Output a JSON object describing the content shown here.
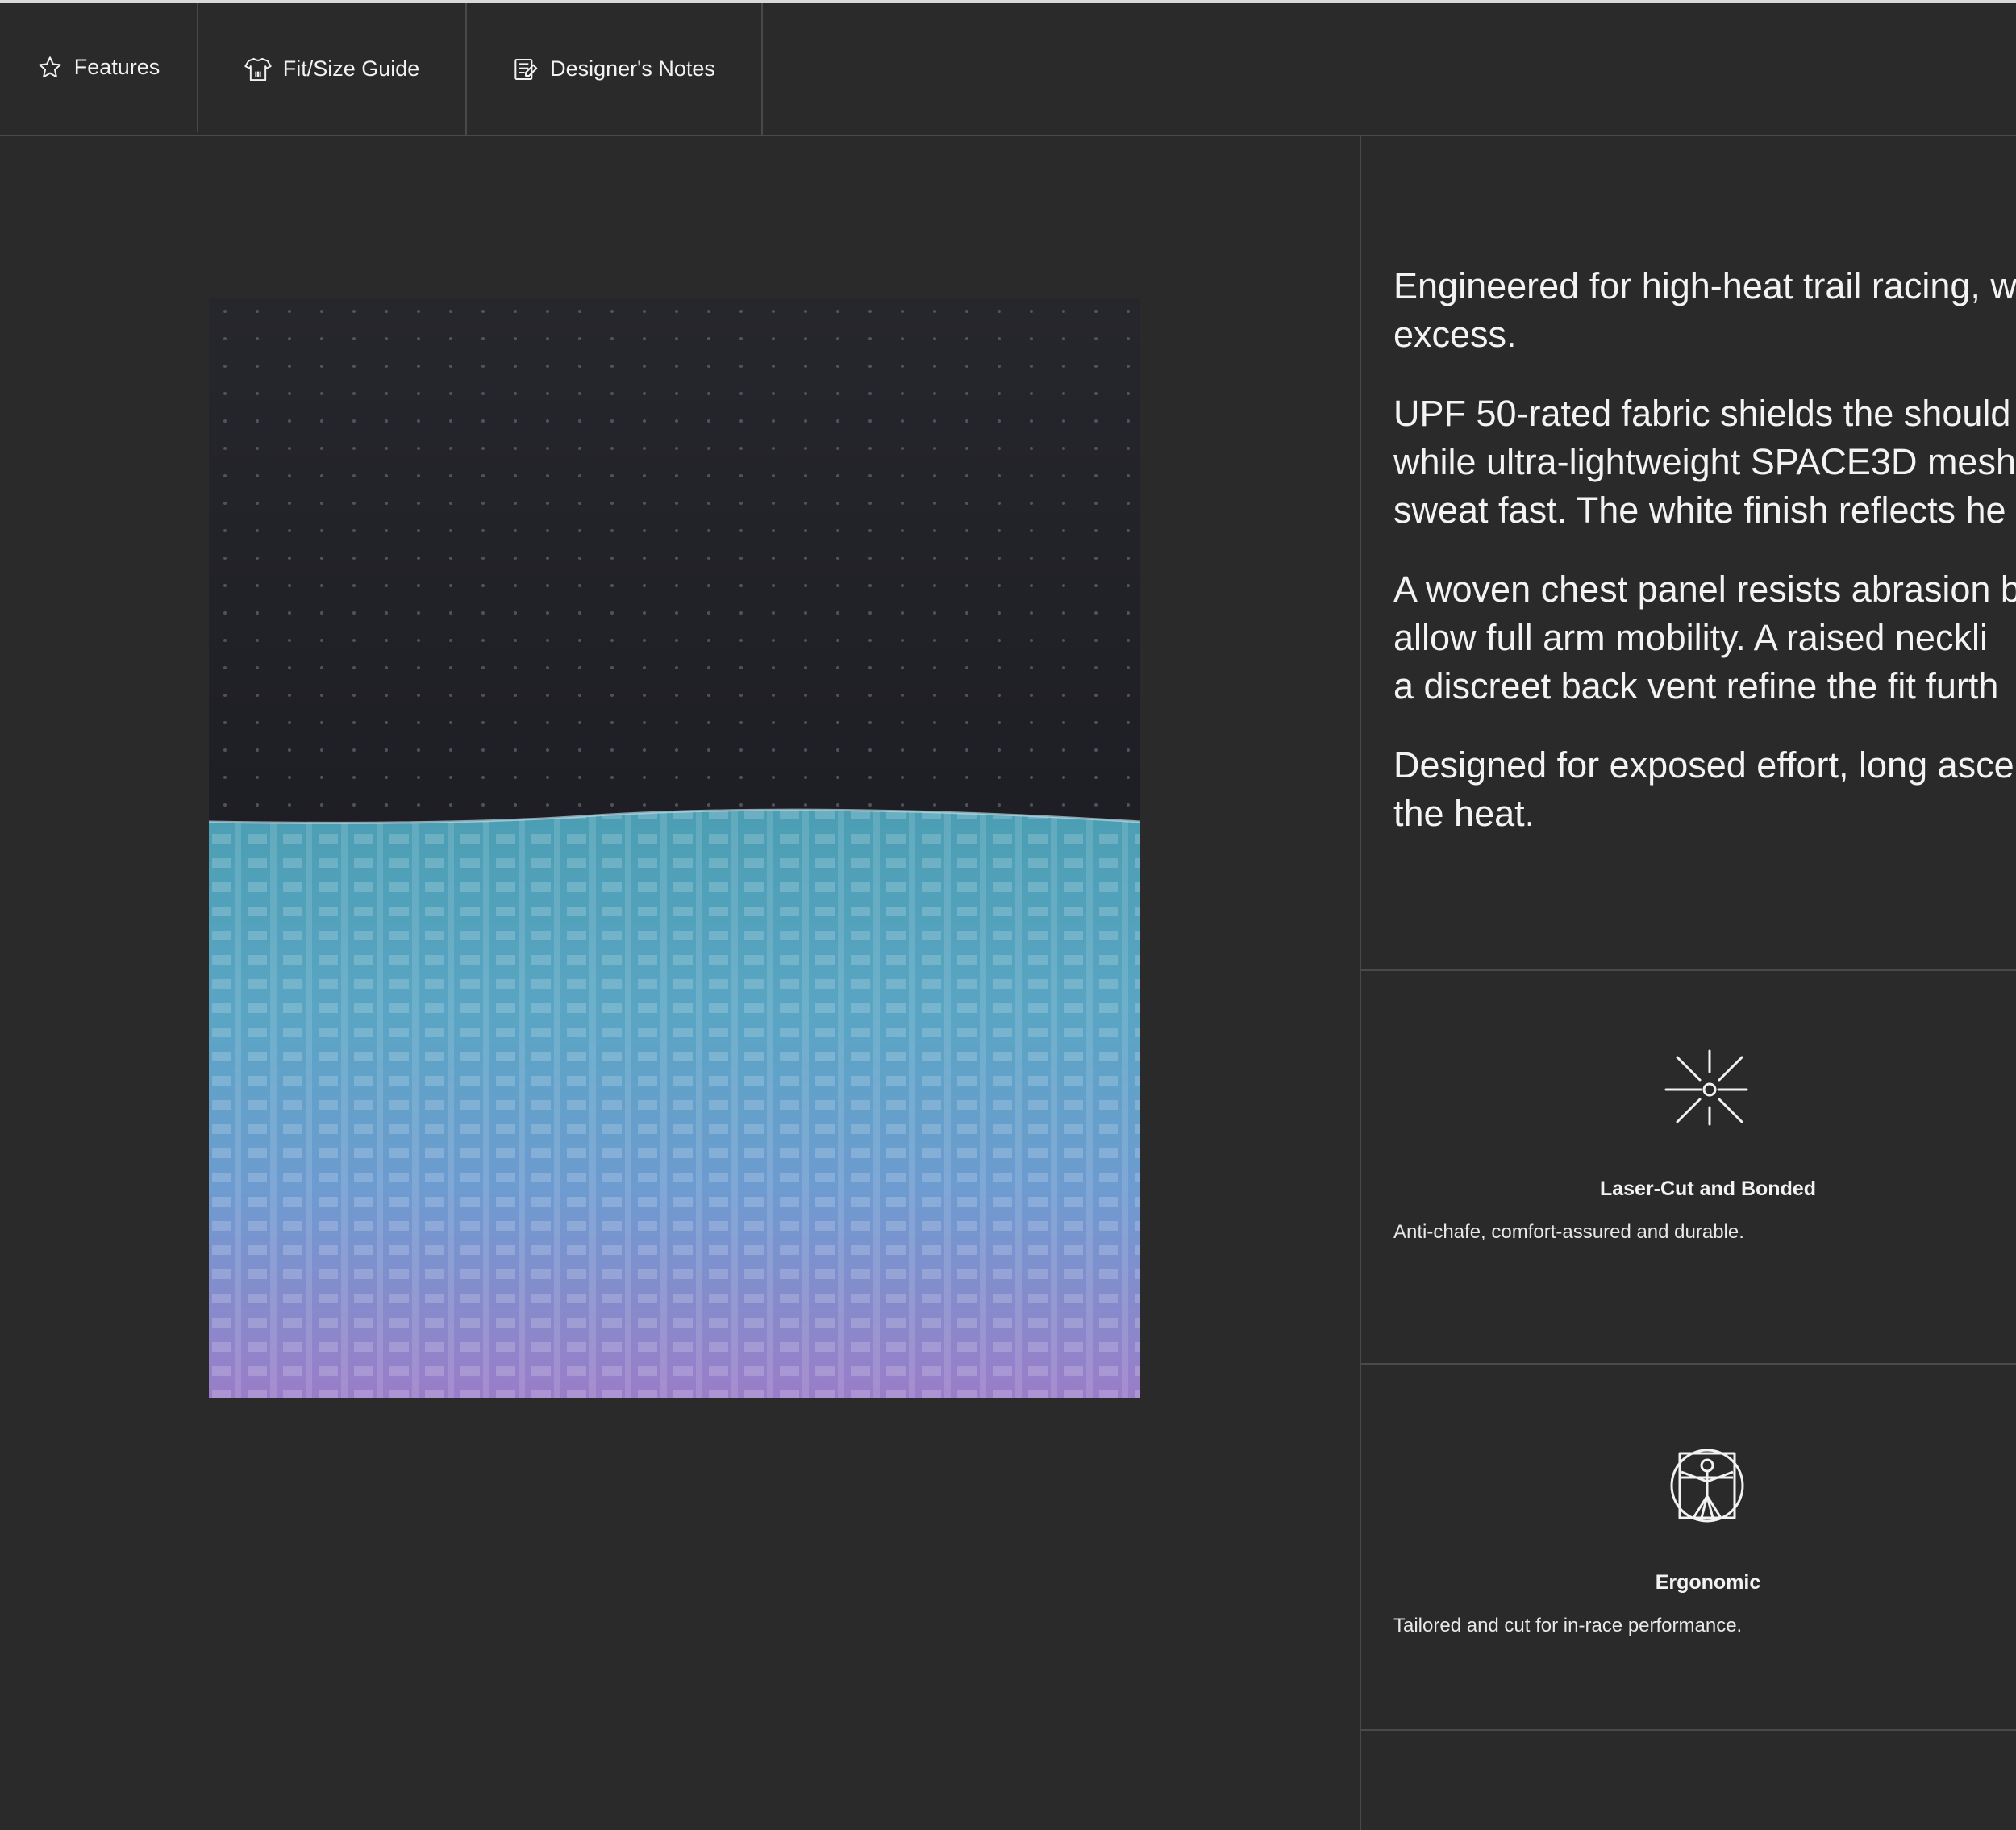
{
  "tabs": [
    {
      "label": "Features",
      "icon": "star-icon",
      "active": true
    },
    {
      "label": "Fit/Size Guide",
      "icon": "tshirt-icon",
      "active": false
    },
    {
      "label": "Designer's Notes",
      "icon": "notes-icon",
      "active": false
    }
  ],
  "product_image": {
    "subject": "fabric close-up, black knit over turquoise-to-purple waffle mesh"
  },
  "description": {
    "p1": "Engineered for high-heat trail racing, w",
    "p1b": "excess.",
    "p2a": "UPF 50-rated fabric shields the should",
    "p2b": "while ultra-lightweight SPACE3D mesh",
    "p2c": "sweat fast. The white finish reflects he",
    "p3a": "A woven chest panel resists abrasion b",
    "p3b": "allow full arm mobility. A raised neckli",
    "p3c": "a discreet back vent refine the fit furth",
    "p4a": "Designed for exposed effort, long asce",
    "p4b": "the heat."
  },
  "features": [
    {
      "icon": "laser-burst-icon",
      "title": "Laser-Cut and Bonded",
      "text": "Anti-chafe, comfort-assured and durable."
    },
    {
      "icon": "vitruvian-man-icon",
      "title": "Ergonomic",
      "text": "Tailored and cut for in-race performance."
    }
  ],
  "colors": {
    "background": "#2b2a2b",
    "divider": "#4a494a",
    "text": "#f2f2f2"
  }
}
